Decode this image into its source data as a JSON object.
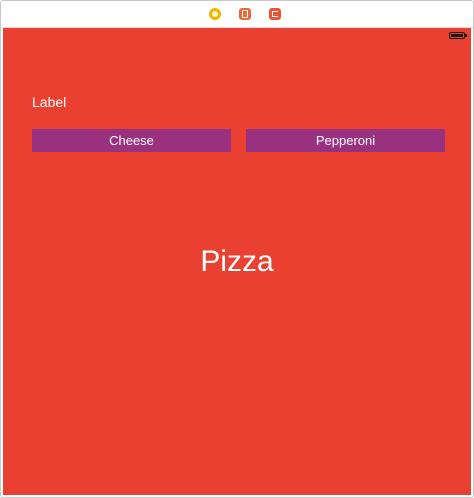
{
  "scene_dock": {
    "icons": [
      "view-controller-icon",
      "first-responder-icon",
      "exit-icon"
    ]
  },
  "view": {
    "background_color": "#ea4032",
    "label_text": "Label",
    "buttons": [
      {
        "label": "Cheese",
        "color": "#9a317f"
      },
      {
        "label": "Pepperoni",
        "color": "#9a317f"
      }
    ],
    "title": "Pizza"
  }
}
